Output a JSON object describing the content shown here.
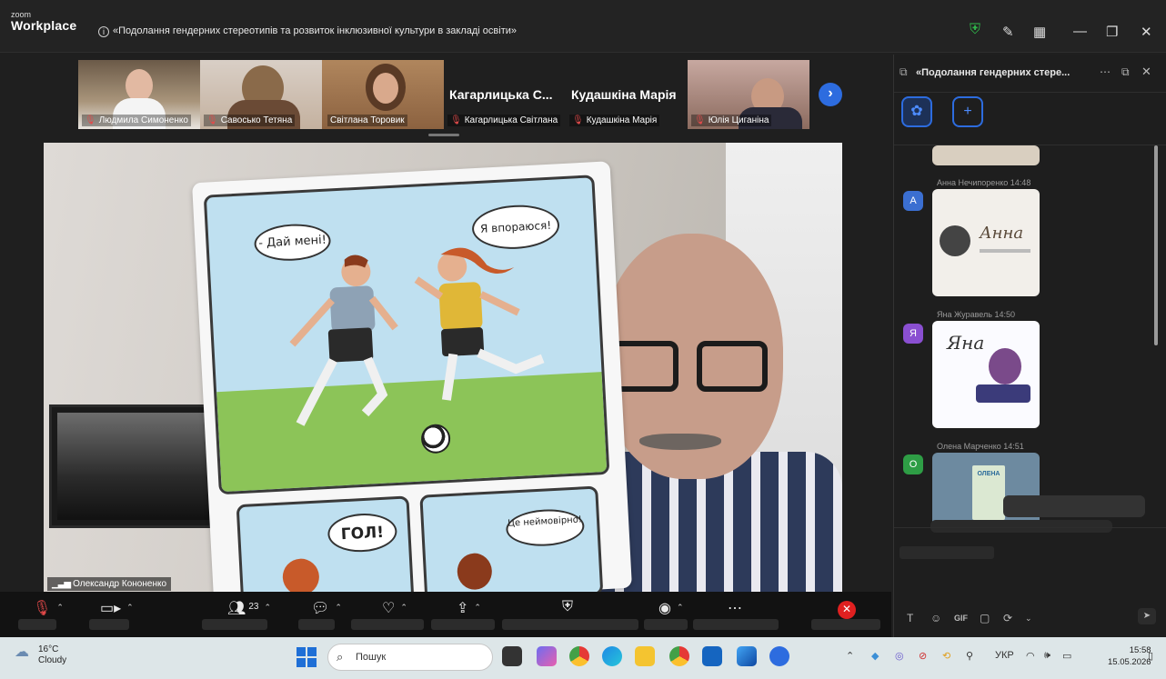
{
  "window": {
    "logo_small": "zoom",
    "logo_main": "Workplace",
    "title": "«Подолання гендерних стереотипів та  розвиток інклюзивної культури в закладі освіти»",
    "controls": {
      "minimize": "—",
      "maximize": "❐",
      "close": "✕"
    }
  },
  "participants": [
    {
      "name": "Людмила Симоненко",
      "muted": true
    },
    {
      "name": "Савосько Тетяна",
      "muted": true
    },
    {
      "name": "Світлана Торовик",
      "muted": false
    },
    {
      "name": "Кагарлицька Світлана",
      "display": "Кагарлицька  С...",
      "muted": true
    },
    {
      "name": "Кудашкіна Марія",
      "display": "Кудашкіна Марія",
      "muted": true
    },
    {
      "name": "Юлія Циганіна",
      "muted": true
    }
  ],
  "main_video": {
    "speaker_name": "Олександр Кононенко",
    "comic": {
      "bubble_1": "- Дай мені!",
      "bubble_2": "Я впораюся!",
      "bubble_3": "ГОЛ!",
      "bubble_4": "Це неймовірно!"
    }
  },
  "toolbar": {
    "participants_count": "23",
    "icons": [
      "mic-muted-icon",
      "video-icon",
      "participants-icon",
      "chat-icon",
      "reactions-icon",
      "share-icon",
      "security-icon",
      "record-icon",
      "more-icon",
      "end-icon"
    ]
  },
  "chat": {
    "title": "«Подолання гендерних стере...",
    "messages": [
      {
        "avatar": "А",
        "name": "Анна Нечипоренко",
        "time": "14:48",
        "color": "#3b6fd1",
        "card_text": "Анна"
      },
      {
        "avatar": "Я",
        "name": "Яна Журавель",
        "time": "14:50",
        "color": "#8a4fd1",
        "card_text": "Яна"
      },
      {
        "avatar": "О",
        "name": "Олена Марченко",
        "time": "14:51",
        "color": "#2e9d45",
        "card_text": "ОЛЕНА"
      }
    ],
    "input_icons": [
      "T",
      "☺",
      "GIF"
    ]
  },
  "taskbar": {
    "weather_temp": "16°C",
    "weather_desc": "Cloudy",
    "search_placeholder": "Пошук",
    "language": "УКР",
    "time": "15:58",
    "date": "15.05.2026"
  }
}
